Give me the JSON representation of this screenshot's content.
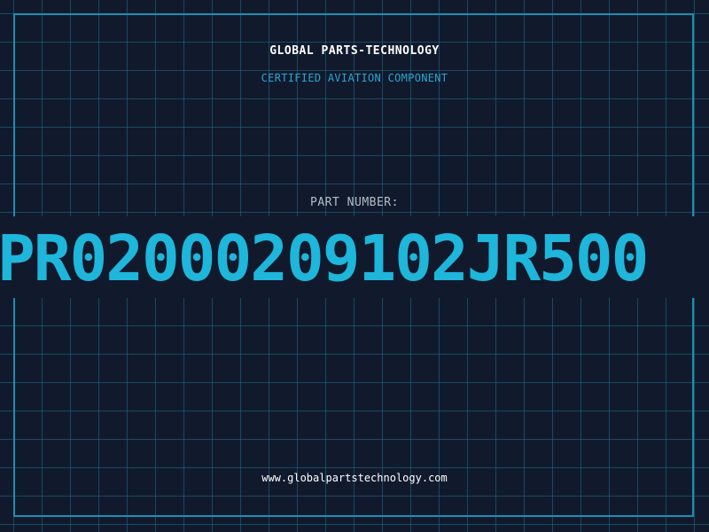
{
  "header": {
    "company": "GLOBAL PARTS-TECHNOLOGY",
    "subtitle": "CERTIFIED AVIATION COMPONENT"
  },
  "part": {
    "label": "PART NUMBER:",
    "number": "PR02000209102JR500"
  },
  "footer": {
    "website": "www.globalpartstechnology.com"
  },
  "colors": {
    "background": "#111a2d",
    "accent": "#1eb6da",
    "frame": "#1b8fb2"
  }
}
